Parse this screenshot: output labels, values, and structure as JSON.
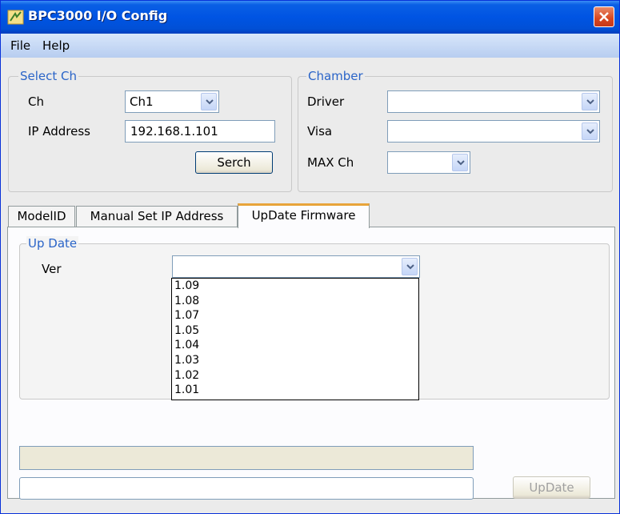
{
  "window": {
    "title": "BPC3000 I/O Config"
  },
  "menu": {
    "file": "File",
    "help": "Help"
  },
  "select_ch": {
    "legend": "Select Ch",
    "ch_label": "Ch",
    "ch_value": "Ch1",
    "ip_label": "IP Address",
    "ip_value": "192.168.1.101",
    "search_label": "Serch"
  },
  "chamber": {
    "legend": "Chamber",
    "driver_label": "Driver",
    "driver_value": "",
    "visa_label": "Visa",
    "visa_value": "",
    "maxch_label": "MAX Ch",
    "maxch_value": ""
  },
  "tabs": [
    {
      "label": "ModelID"
    },
    {
      "label": "Manual Set IP Address"
    },
    {
      "label": "UpDate Firmware"
    }
  ],
  "update": {
    "legend": "Up Date",
    "ver_label": "Ver",
    "ver_value": "",
    "versions": [
      "1.09",
      "1.08",
      "1.07",
      "1.05",
      "1.04",
      "1.03",
      "1.02",
      "1.01"
    ],
    "status_value": "",
    "update_button": "UpDate"
  },
  "colors": {
    "title_blue": "#0054e3",
    "legend_blue": "#2a64c8",
    "tab_highlight": "#e8a43a",
    "close_red": "#d8461f"
  }
}
